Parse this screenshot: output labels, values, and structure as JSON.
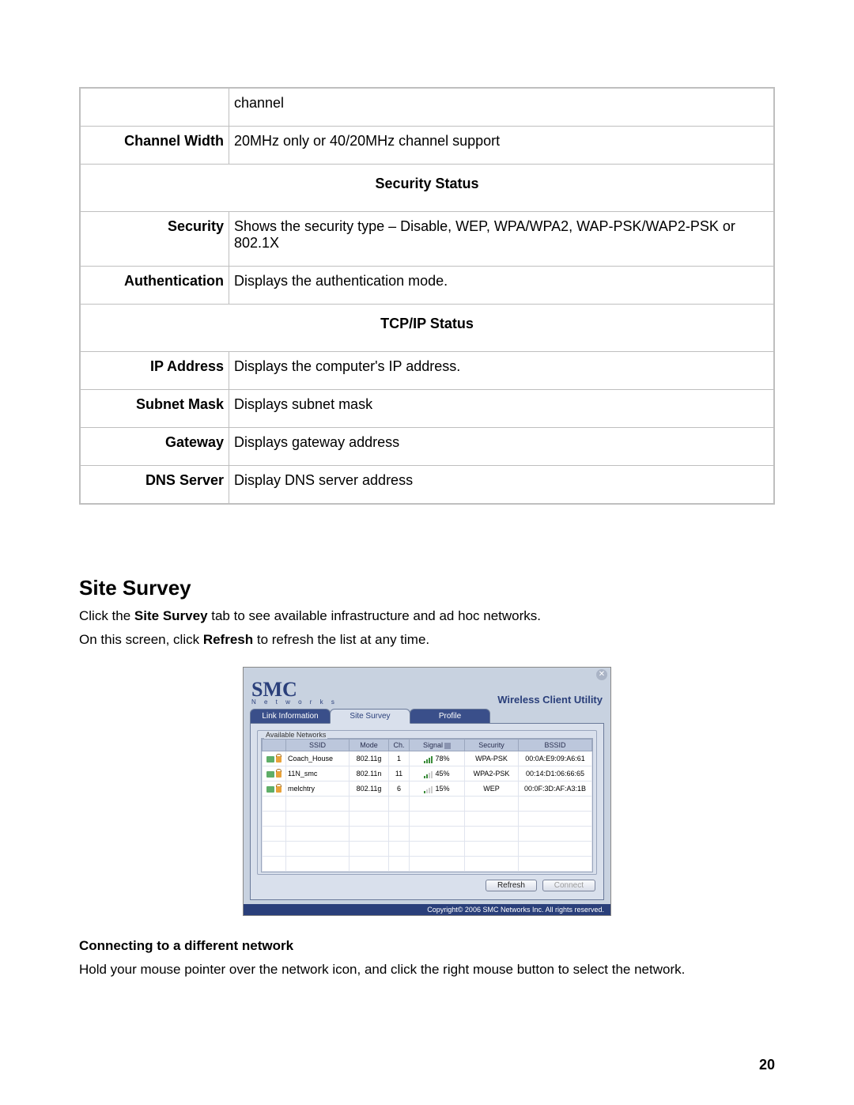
{
  "table": {
    "rows": [
      {
        "label": "",
        "desc": "channel"
      },
      {
        "label": "Channel Width",
        "desc": "20MHz only or 40/20MHz channel support"
      }
    ],
    "security_header": "Security Status",
    "security_rows": [
      {
        "label": "Security",
        "desc": "Shows the security type – Disable, WEP, WPA/WPA2, WAP-PSK/WAP2-PSK or 802.1X"
      },
      {
        "label": "Authentication",
        "desc": "Displays the authentication mode."
      }
    ],
    "tcpip_header": "TCP/IP Status",
    "tcpip_rows": [
      {
        "label": "IP Address",
        "desc": "Displays the computer's IP address."
      },
      {
        "label": "Subnet Mask",
        "desc": "Displays subnet mask"
      },
      {
        "label": "Gateway",
        "desc": "Displays gateway address"
      },
      {
        "label": "DNS Server",
        "desc": "Display DNS server address"
      }
    ]
  },
  "heading": "Site Survey",
  "intro": {
    "pre1": "Click the ",
    "bold1": "Site Survey",
    "post1": " tab to see available infrastructure and ad hoc networks.",
    "pre2": "On this screen, click ",
    "bold2": "Refresh",
    "post2": " to refresh the list at any time."
  },
  "utility": {
    "logo": "SMC",
    "logo_sub": "N e t w o r k s",
    "title": "Wireless Client Utility",
    "tabs": {
      "link": "Link Information",
      "survey": "Site Survey",
      "profile": "Profile"
    },
    "fieldset": "Available Networks",
    "headers": {
      "ssid": "SSID",
      "mode": "Mode",
      "ch": "Ch.",
      "signal": "Signal",
      "security": "Security",
      "bssid": "BSSID"
    },
    "rows": [
      {
        "ssid": "Coach_House",
        "mode": "802.11g",
        "ch": "1",
        "signal": "78%",
        "bars": 4,
        "security": "WPA-PSK",
        "bssid": "00:0A:E9:09:A6:61"
      },
      {
        "ssid": "11N_smc",
        "mode": "802.11n",
        "ch": "11",
        "signal": "45%",
        "bars": 2,
        "security": "WPA2-PSK",
        "bssid": "00:14:D1:06:66:65"
      },
      {
        "ssid": "melchtry",
        "mode": "802.11g",
        "ch": "6",
        "signal": "15%",
        "bars": 1,
        "security": "WEP",
        "bssid": "00:0F:3D:AF:A3:1B"
      }
    ],
    "buttons": {
      "refresh": "Refresh",
      "connect": "Connect"
    },
    "footer": "Copyright© 2006 SMC Networks Inc. All rights reserved."
  },
  "subheading": "Connecting to a different network",
  "sub_body": "Hold your mouse pointer over the network icon, and click the right mouse button to select the network.",
  "page_number": "20"
}
